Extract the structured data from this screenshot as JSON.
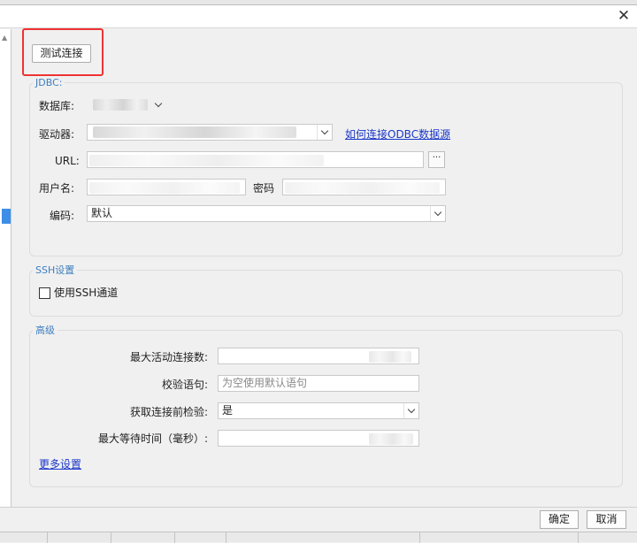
{
  "window": {
    "close_glyph": "✕"
  },
  "toolbar": {
    "test_connection_label": "测试连接"
  },
  "jdbc": {
    "group_title": "JDBC:",
    "database_label": "数据库:",
    "driver_label": "驱动器:",
    "odbc_help_link": "如何连接ODBC数据源",
    "url_label": "URL:",
    "url_browse_label": "···",
    "username_label": "用户名:",
    "password_label": "密码",
    "encoding_label": "编码:",
    "encoding_value": "默认"
  },
  "ssh": {
    "group_title": "SSH设置",
    "use_ssh_label": "使用SSH通道",
    "use_ssh_checked": false
  },
  "advanced": {
    "group_title": "高级",
    "max_active_label": "最大活动连接数:",
    "validation_query_label": "校验语句:",
    "validation_query_placeholder": "为空使用默认语句",
    "test_before_borrow_label": "获取连接前检验:",
    "test_before_borrow_value": "是",
    "max_wait_label": "最大等待时间（毫秒）:",
    "more_settings_link": "更多设置"
  },
  "footer": {
    "ok_label": "确定",
    "cancel_label": "取消"
  },
  "colors": {
    "group_title": "#3d7fc0",
    "link": "#1a36c9",
    "highlight": "#ee3333"
  }
}
